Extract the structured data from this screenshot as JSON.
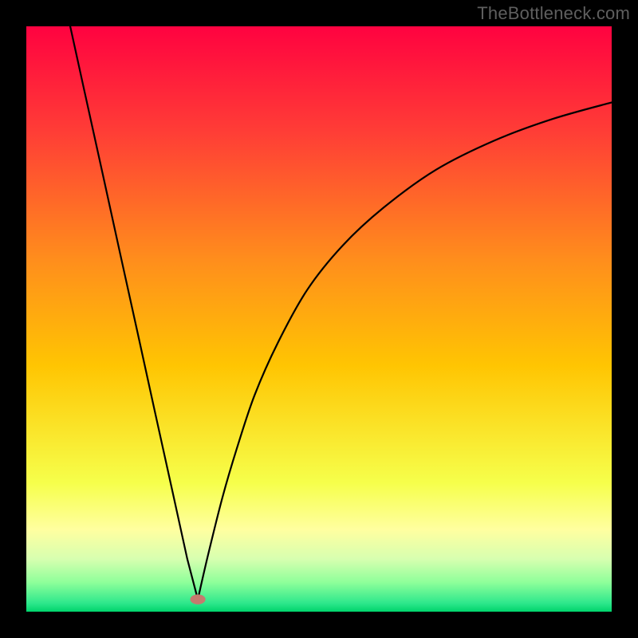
{
  "watermark": "TheBottleneck.com",
  "chart_data": {
    "type": "line",
    "title": "",
    "xlabel": "",
    "ylabel": "",
    "xlim": [
      0,
      1
    ],
    "ylim": [
      0,
      1
    ],
    "grid": false,
    "legend": false,
    "background_gradient": {
      "top": "#ff0240",
      "mid_upper": "#fe5d32",
      "mid": "#ffc502",
      "mid_lower": "#f6ff4b",
      "near_bottom": "#8eff9a",
      "bottom": "#00d46c"
    },
    "marker": {
      "shape": "ellipse",
      "color": "#c57a6e",
      "x": 0.293,
      "y": 0.021,
      "rx": 0.013,
      "ry": 0.0085
    },
    "curve_description": "V-shaped bottleneck curve; left branch descends steeply and nearly linearly from top-left frame edge to the minimum near x≈0.29; right branch rises with decreasing slope (concave) toward upper right, exiting near y≈0.87 at x=1.",
    "series": [
      {
        "name": "left-branch",
        "x": [
          0.075,
          0.1,
          0.13,
          0.16,
          0.19,
          0.22,
          0.25,
          0.275,
          0.293
        ],
        "y": [
          1.0,
          0.886,
          0.75,
          0.613,
          0.477,
          0.34,
          0.204,
          0.09,
          0.021
        ]
      },
      {
        "name": "right-branch",
        "x": [
          0.293,
          0.31,
          0.335,
          0.36,
          0.39,
          0.43,
          0.48,
          0.54,
          0.61,
          0.7,
          0.8,
          0.9,
          1.0
        ],
        "y": [
          0.021,
          0.095,
          0.195,
          0.28,
          0.37,
          0.46,
          0.55,
          0.625,
          0.69,
          0.755,
          0.805,
          0.842,
          0.87
        ]
      }
    ]
  }
}
